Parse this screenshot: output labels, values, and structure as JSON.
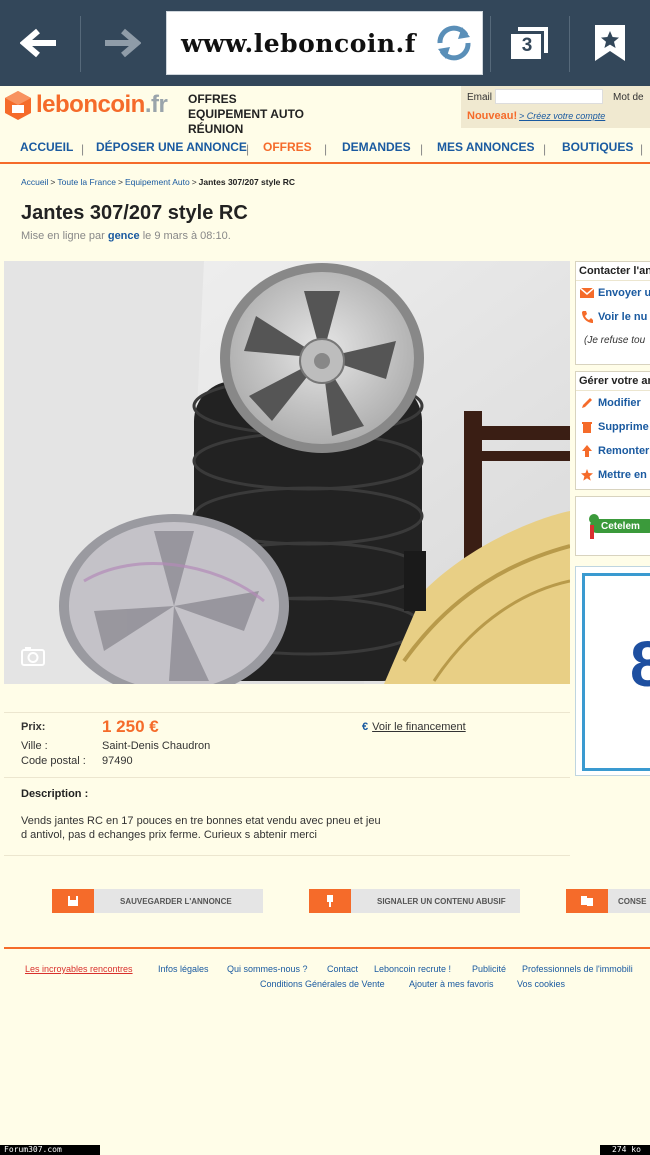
{
  "browser": {
    "url": "www.leboncoin.f",
    "tab_count": "3",
    "back_icon": "back-arrow-icon",
    "forward_icon": "forward-arrow-icon",
    "reload_icon": "reload-icon",
    "bookmark_icon": "bookmark-star-icon"
  },
  "header": {
    "logo_main": "leboncoin",
    "logo_tld": ".fr",
    "offers_title": [
      "OFFRES",
      "EQUIPEMENT AUTO",
      "RÉUNION"
    ],
    "login": {
      "email_label": "Email",
      "password_label": "Mot de",
      "nouveau": "Nouveau!",
      "create_account": "> Créez votre compte"
    }
  },
  "nav": {
    "items": [
      "ACCUEIL",
      "DÉPOSER UNE ANNONCE",
      "OFFRES",
      "DEMANDES",
      "MES ANNONCES",
      "BOUTIQUES"
    ],
    "active": "OFFRES"
  },
  "breadcrumb": {
    "items": [
      "Accueil",
      "Toute la France",
      "Equipement Auto"
    ],
    "current": "Jantes 307/207 style RC"
  },
  "ad": {
    "title": "Jantes 307/207 style RC",
    "posted_prefix": "Mise en ligne par",
    "posted_user": "gence",
    "posted_suffix": "le 9 mars à 08:10.",
    "price_label": "Prix:",
    "price": "1 250 €",
    "city_label": "Ville :",
    "city": "Saint-Denis Chaudron",
    "postal_label": "Code postal :",
    "postal": "97490",
    "financing": "Voir le financement",
    "description_label": "Description :",
    "description": "Vends jantes RC en 17 pouces en tre bonnes etat vendu avec pneu et jeu d antivol, pas d echanges prix ferme. Curieux s abtenir merci"
  },
  "actions": [
    {
      "label": "SAUVEGARDER L'ANNONCE",
      "icon": "save-icon"
    },
    {
      "label": "SIGNALER UN CONTENU ABUSIF",
      "icon": "flag-icon"
    },
    {
      "label": "CONSE",
      "icon": "advice-icon"
    }
  ],
  "sidebar": {
    "contact_title": "Contacter l'an",
    "contact_items": [
      "Envoyer u",
      "Voir le nu"
    ],
    "refuse": "(Je refuse tou",
    "manage_title": "Gérer votre an",
    "manage_items": [
      "Modifier",
      "Supprime",
      "Remonter",
      "Mettre en"
    ],
    "cetelem": "Cetelem",
    "ad_digit": "8"
  },
  "footer": {
    "links_row1": [
      "Les incroyables rencontres",
      "Infos légales",
      "Qui sommes-nous ?",
      "Contact",
      "Leboncoin recrute !",
      "Publicité",
      "Professionnels de l'immobili"
    ],
    "links_row2": [
      "Conditions Générales de Vente",
      "Ajouter à mes favoris",
      "Vos cookies"
    ]
  },
  "watermarks": {
    "left": "Forum307.com",
    "right": "274 ko"
  },
  "colors": {
    "brand_orange": "#f56b2a",
    "link_blue": "#1a5aa0",
    "page_bg": "#fffde8",
    "chrome_bg": "#33475a"
  }
}
